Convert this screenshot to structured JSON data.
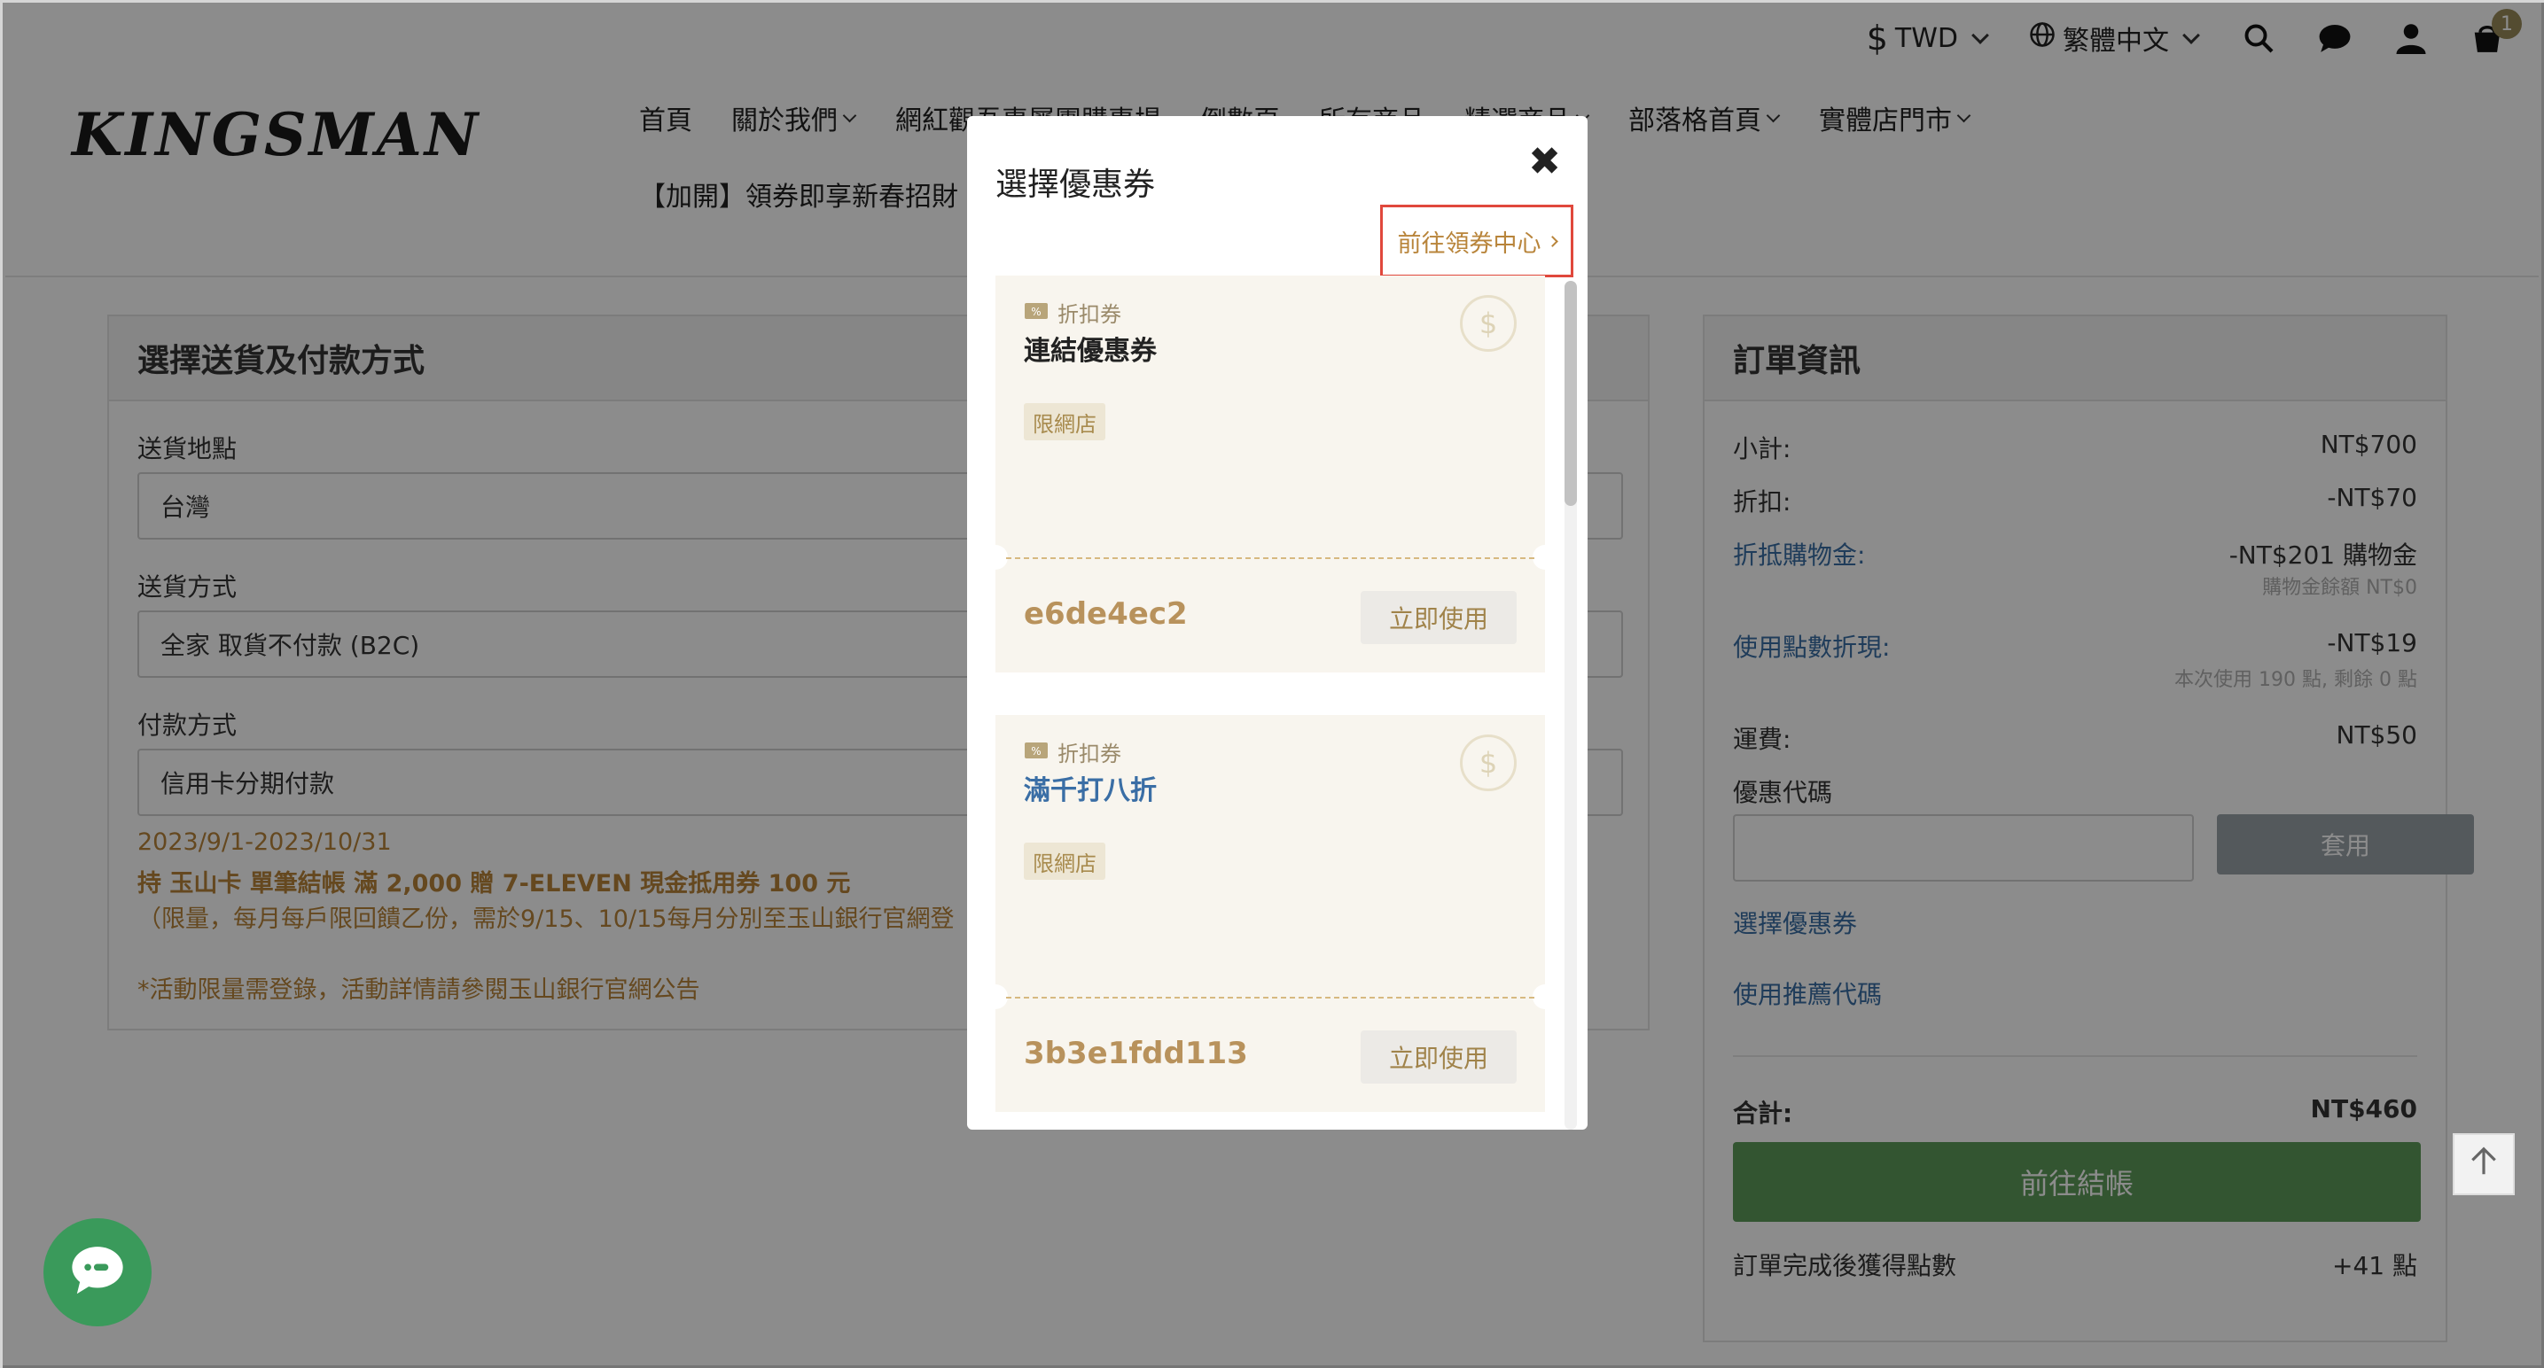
{
  "topbar": {
    "currency_symbol": "$",
    "currency": "TWD",
    "language": "繁體中文",
    "cart_count": "1"
  },
  "header": {
    "logo": "KINGSMAN",
    "nav": [
      "首頁",
      "關於我們",
      "網紅觀吾專屬團購專場",
      "倒數頁",
      "所有商品",
      "精選商品",
      "部落格首頁",
      "實體店門市"
    ],
    "promo": "【加開】領券即享新春招財"
  },
  "shipping": {
    "title": "選擇送貨及付款方式",
    "location_label": "送貨地點",
    "location_value": "台灣",
    "method_label": "送貨方式",
    "method_value": "全家 取貨不付款 (B2C)",
    "payment_label": "付款方式",
    "payment_value": "信用卡分期付款",
    "notes": [
      "2023/9/1-2023/10/31",
      "持 玉山卡 單筆結帳 滿 2,000 贈 7-ELEVEN 現金抵用券 100 元",
      "（限量，每月每戶限回饋乙份，需於9/15、10/15每月分別至玉山銀行官網登",
      "*活動限量需登錄，活動詳情請參閱玉山銀行官網公告"
    ]
  },
  "order": {
    "title": "訂單資訊",
    "subtotal_label": "小計:",
    "subtotal": "NT$700",
    "discount_label": "折扣:",
    "discount": "-NT$70",
    "credit_label": "折抵購物金:",
    "credit": "-NT$201 購物金",
    "credit_note": "購物金餘額 NT$0",
    "points_label": "使用點數折現:",
    "points": "-NT$19",
    "points_note": "本次使用 190 點, 剩餘 0 點",
    "shipping_label": "運費:",
    "shipping": "NT$50",
    "code_label": "優惠代碼",
    "code_value": "",
    "apply_label": "套用",
    "select_coupon_link": "選擇優惠券",
    "referral_link": "使用推薦代碼",
    "total_label": "合計:",
    "total": "NT$460",
    "checkout_label": "前往結帳",
    "earn_label": "訂單完成後獲得點數",
    "earn_value": "+41 點"
  },
  "modal": {
    "title": "選擇優惠券",
    "close": "✖",
    "center_link": "前往領券中心",
    "coupons": [
      {
        "type": "折扣券",
        "name": "連結優惠券",
        "tag": "限網店",
        "code": "e6de4ec2",
        "use_label": "立即使用"
      },
      {
        "type": "折扣券",
        "name": "滿千打八折",
        "tag": "限網店",
        "code": "3b3e1fdd113",
        "use_label": "立即使用"
      }
    ]
  },
  "colors": {
    "accent_gold": "#b8843a",
    "link_blue": "#3a6ea5",
    "checkout_green": "#5d9c59",
    "highlight_red": "#e0483c"
  },
  "icons": [
    "search-icon",
    "chat-icon",
    "user-icon",
    "cart-icon",
    "globe-icon",
    "close-icon",
    "coupon-icon",
    "dollar-icon",
    "arrow-up-icon",
    "chat-bubble-icon"
  ]
}
